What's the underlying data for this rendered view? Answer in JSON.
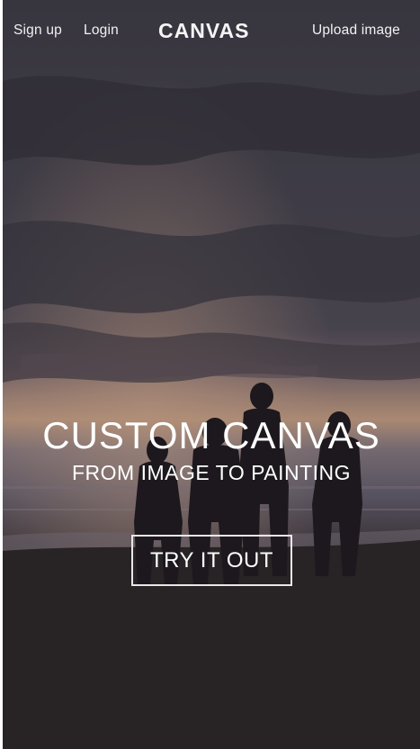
{
  "nav": {
    "signup_label": "Sign up",
    "login_label": "Login",
    "brand": "CANVAS",
    "upload_label": "Upload image"
  },
  "hero": {
    "title": "CUSTOM CANVAS",
    "subtitle": "FROM IMAGE TO PAINTING",
    "cta_label": "TRY IT OUT",
    "background": "photo-sunset-beach-silhouettes"
  },
  "colors": {
    "sky_top": "#3c3a44",
    "sky_mid": "#4b4550",
    "horizon_glow": "#b9957d",
    "sea": "#5f5a68",
    "sand": "#2c2629",
    "text": "#ffffff"
  }
}
